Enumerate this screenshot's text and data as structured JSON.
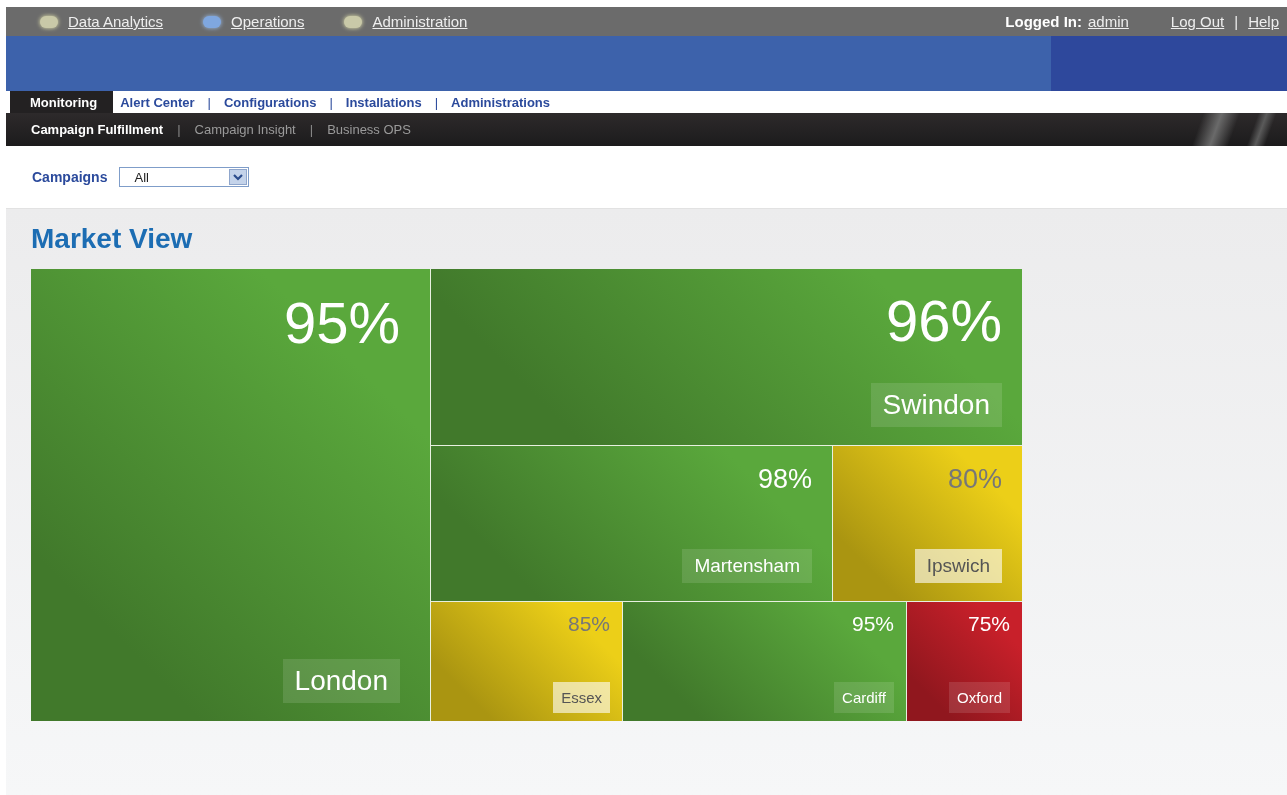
{
  "top_nav": {
    "items": [
      {
        "label": "Data Analytics",
        "selected": false
      },
      {
        "label": "Operations",
        "selected": true
      },
      {
        "label": "Administration",
        "selected": false
      }
    ],
    "logged_in_label": "Logged In:",
    "user": "admin",
    "links": [
      "Log Out",
      "Help"
    ],
    "separator": "|"
  },
  "tabs": [
    {
      "label": "Monitoring",
      "selected": true
    },
    {
      "label": "Alert Center",
      "selected": false
    },
    {
      "label": "Configurations",
      "selected": false
    },
    {
      "label": "Installations",
      "selected": false
    },
    {
      "label": "Administrations",
      "selected": false
    }
  ],
  "tab_separator": "|",
  "sub_nav": [
    {
      "label": "Campaign Fulfillment",
      "selected": true
    },
    {
      "label": "Campaign Insight",
      "selected": false
    },
    {
      "label": "Business OPS",
      "selected": false
    }
  ],
  "filter": {
    "label": "Campaigns",
    "value": "All"
  },
  "title": "Market View",
  "tiles": [
    {
      "percent": "95%",
      "name": "London",
      "color": "#5aa83c"
    },
    {
      "percent": "96%",
      "name": "Swindon",
      "color": "#5aa83c"
    },
    {
      "percent": "98%",
      "name": "Martensham",
      "color": "#5aa83c"
    },
    {
      "percent": "80%",
      "name": "Ipswich",
      "color": "#eccf18"
    },
    {
      "percent": "85%",
      "name": "Essex",
      "color": "#eccf18"
    },
    {
      "percent": "95%",
      "name": "Cardiff",
      "color": "#5aa83c"
    },
    {
      "percent": "75%",
      "name": "Oxford",
      "color": "#c8202a"
    }
  ]
}
